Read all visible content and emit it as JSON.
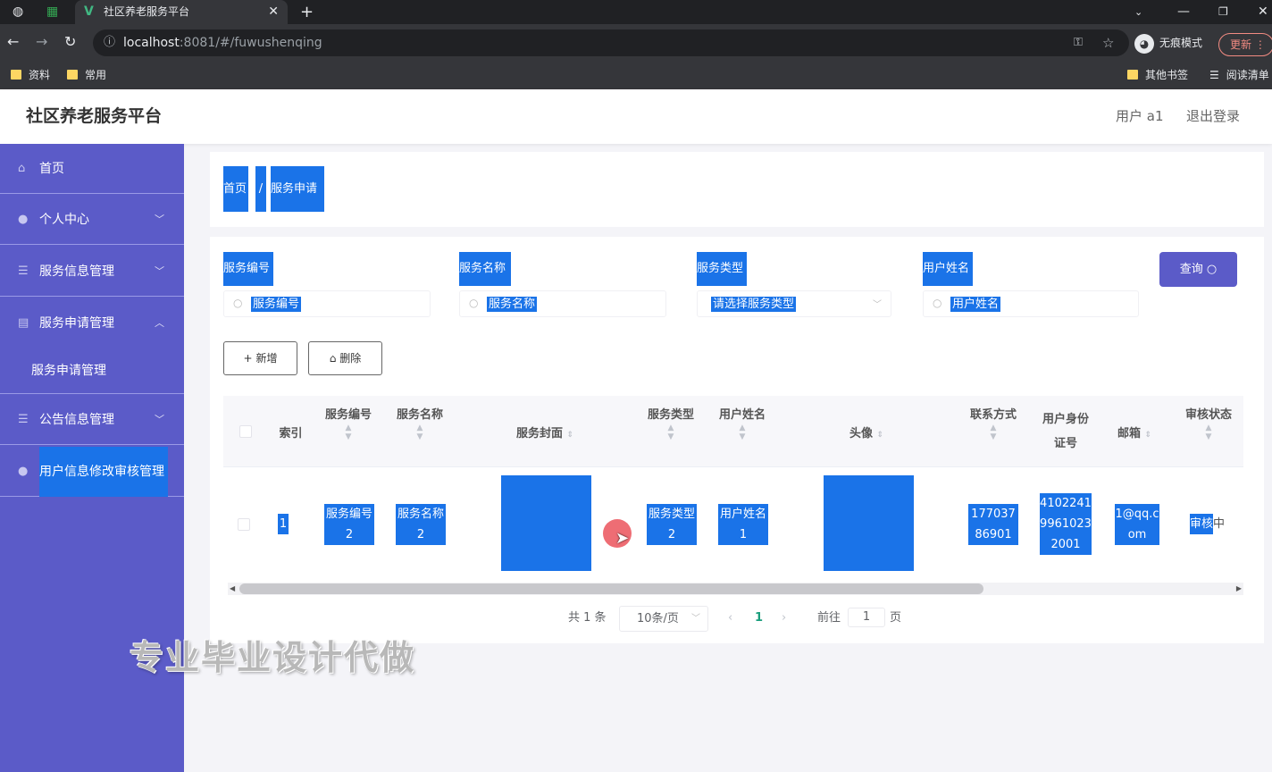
{
  "browser": {
    "tab_title": "社区养老服务平台",
    "url_host": "localhost",
    "url_rest": ":8081/#/fuwushenqing",
    "incognito_label": "无痕模式",
    "update_label": "更新",
    "bookmarks": [
      "资料",
      "常用"
    ],
    "other_bookmarks": "其他书签",
    "reading_list": "阅读清单"
  },
  "header": {
    "title": "社区养老服务平台",
    "user_label": "用户 a1",
    "logout_label": "退出登录"
  },
  "sidebar": {
    "items": [
      {
        "label": "首页",
        "icon": "home-icon"
      },
      {
        "label": "个人中心",
        "icon": "user-icon"
      },
      {
        "label": "服务信息管理",
        "icon": "list-icon"
      },
      {
        "label": "服务申请管理",
        "icon": "clipboard-icon"
      },
      {
        "label": "公告信息管理",
        "icon": "list-icon"
      },
      {
        "label": "用户信息修改审核管理",
        "icon": "user-icon"
      }
    ],
    "subitem": "服务申请管理"
  },
  "breadcrumb": {
    "home": "首页",
    "separator": "/",
    "current": "服务申请"
  },
  "filters": {
    "service_no": {
      "label": "服务编号",
      "placeholder": "服务编号"
    },
    "service_name": {
      "label": "服务名称",
      "placeholder": "服务名称"
    },
    "service_type": {
      "label": "服务类型",
      "placeholder": "请选择服务类型"
    },
    "user_name": {
      "label": "用户姓名",
      "placeholder": "用户姓名"
    },
    "query_label": "查询"
  },
  "actions": {
    "add_label": "新增",
    "delete_label": "删除"
  },
  "table": {
    "headers": {
      "index": "索引",
      "service_no": "服务编号",
      "service_name": "服务名称",
      "cover": "服务封面",
      "service_type": "服务类型",
      "user_name": "用户姓名",
      "avatar": "头像",
      "phone": "联系方式",
      "id_card": "用户身份证号",
      "email": "邮箱",
      "status": "审核状态"
    },
    "row": {
      "index": "1",
      "service_no": "服务编号2",
      "service_name": "服务名称2",
      "service_type": "服务类型2",
      "user_name": "用户姓名1",
      "phone": "17703786901",
      "id_card": "410224199610232001",
      "email": "1@qq.com",
      "status_highlight": "审核",
      "status_rest": "中"
    }
  },
  "pagination": {
    "total": "共 1 条",
    "page_size": "10条/页",
    "current_page": "1",
    "goto_label": "前往",
    "goto_value": "1",
    "page_unit": "页"
  },
  "watermark": "专业毕业设计代做"
}
